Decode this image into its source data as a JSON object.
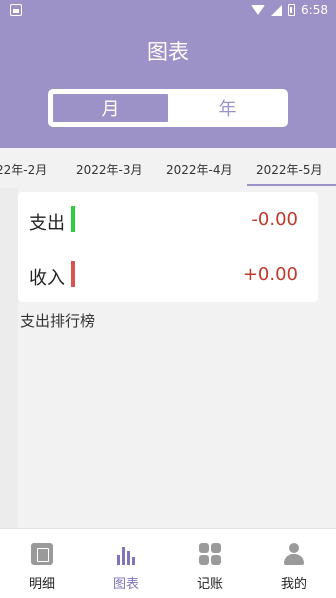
{
  "status_bar": {
    "time": "6:58"
  },
  "header": {
    "title": "图表"
  },
  "segment": {
    "month_label": "月",
    "year_label": "年",
    "selected": "月"
  },
  "month_tabs": [
    {
      "label": "22年-2月"
    },
    {
      "label": "2022年-3月"
    },
    {
      "label": "2022年-4月"
    },
    {
      "label": "2022年-5月",
      "active": true
    }
  ],
  "summary": {
    "expense": {
      "label": "支出",
      "value": "-0.00",
      "indicator_color": "#2ecc40"
    },
    "income": {
      "label": "收入",
      "value": "+0.00",
      "indicator_color": "#d9534f"
    }
  },
  "ranking": {
    "title": "支出排行榜"
  },
  "bottom_nav": [
    {
      "label": "明细",
      "icon": "ledger-icon"
    },
    {
      "label": "图表",
      "icon": "bar-chart-icon",
      "active": true
    },
    {
      "label": "记账",
      "icon": "grid-icon"
    },
    {
      "label": "我的",
      "icon": "user-icon"
    }
  ],
  "colors": {
    "accent": "#9d92c8",
    "value_text": "#c0392b"
  }
}
